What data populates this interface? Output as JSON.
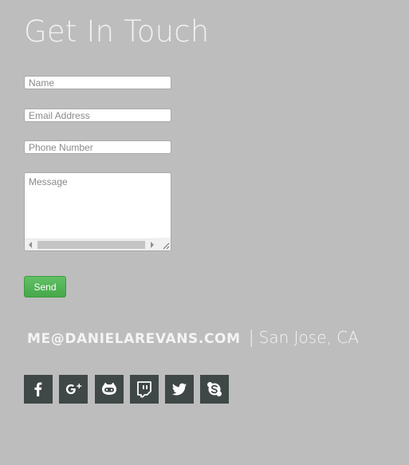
{
  "heading": "Get In Touch",
  "form": {
    "name_placeholder": "Name",
    "email_placeholder": "Email Address",
    "phone_placeholder": "Phone Number",
    "message_placeholder": "Message",
    "send_label": "Send"
  },
  "contact": {
    "email": "ME@DANIELAREVANS.COM",
    "separator": "|",
    "location": "San Jose, CA"
  },
  "socials": [
    {
      "icon": "facebook-icon"
    },
    {
      "icon": "google-plus-icon"
    },
    {
      "icon": "github-icon"
    },
    {
      "icon": "twitch-icon"
    },
    {
      "icon": "twitter-icon"
    },
    {
      "icon": "skype-icon"
    }
  ],
  "colors": {
    "background": "#bdbdbd",
    "send_button": "#4caf50",
    "social_tile": "#3f4747",
    "text_light": "#f4f4f4"
  }
}
